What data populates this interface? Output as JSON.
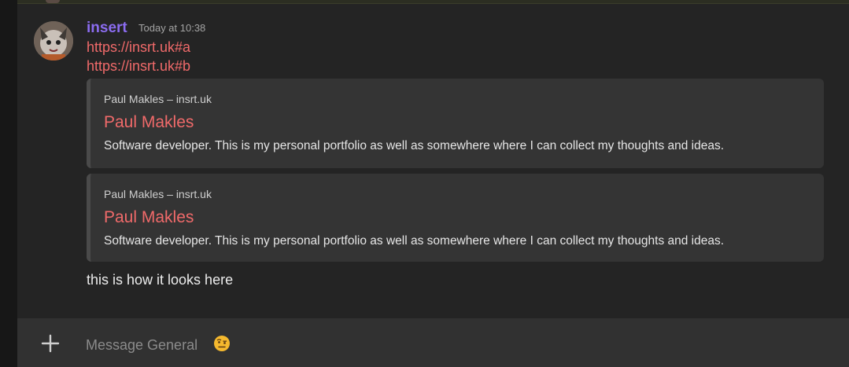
{
  "message": {
    "username": "insert",
    "timestamp": "Today at 10:38",
    "links": [
      "https://insrt.uk#a",
      "https://insrt.uk#b"
    ],
    "embeds": [
      {
        "site": "Paul Makles – insrt.uk",
        "title": "Paul Makles",
        "description": "Software developer. This is my personal portfolio as well as somewhere where I can collect my thoughts and ideas."
      },
      {
        "site": "Paul Makles – insrt.uk",
        "title": "Paul Makles",
        "description": "Software developer. This is my personal portfolio as well as somewhere where I can collect my thoughts and ideas."
      }
    ],
    "text": "this is how it looks here"
  },
  "composer": {
    "placeholder": "Message General",
    "add_icon": "plus-icon",
    "emoji_icon": "raised-eyebrow-emoji-icon"
  },
  "colors": {
    "username": "#8b6cf0",
    "link": "#f06a6a",
    "embed_bg": "#343434"
  }
}
